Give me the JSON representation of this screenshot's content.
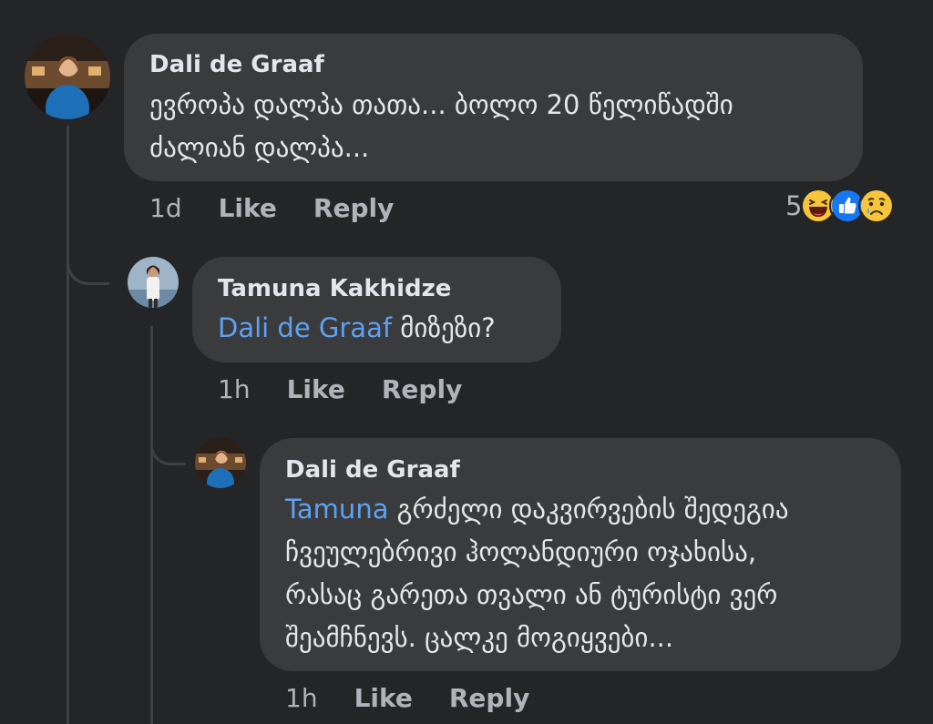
{
  "comments": [
    {
      "author": "Dali de Graaf",
      "text_line1": "ევროპა დალპა თათა... ბოლო 20 წელიწადში",
      "text_line2": "ძალიან დალპა...",
      "time": "1d",
      "like_label": "Like",
      "reply_label": "Reply",
      "reaction_count": "5",
      "reactions": [
        "haha-icon",
        "like-icon",
        "sad-icon"
      ]
    },
    {
      "author": "Tamuna Kakhidze",
      "mention": "Dali de Graaf",
      "text": " მიზეზი?",
      "time": "1h",
      "like_label": "Like",
      "reply_label": "Reply"
    },
    {
      "author": "Dali de Graaf",
      "mention": "Tamuna",
      "text_line1": " გრძელი დაკვირვების შედეგია",
      "text_line2": "ჩვეულებრივი ჰოლანდიური ოჯახისა,",
      "text_line3": "რასაც გარეთა თვალი ან ტურისტი ვერ",
      "text_line4": "შეამჩნევს. ცალკე მოგიყვები...",
      "time": "1h",
      "like_label": "Like",
      "reply_label": "Reply"
    }
  ],
  "colors": {
    "background": "#242527",
    "bubble": "#3a3b3c",
    "text": "#e4e6eb",
    "secondary": "#b0b3b8",
    "mention": "#5ea1f3"
  }
}
